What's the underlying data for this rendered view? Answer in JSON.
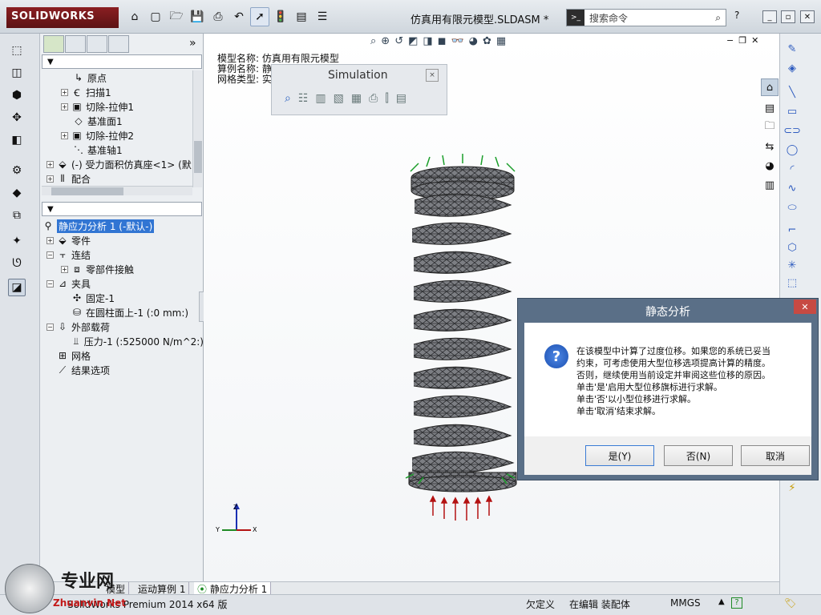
{
  "app": {
    "brand": "SOLIDWORKS",
    "doc_title": "仿真用有限元模型.SLDASM *",
    "search_placeholder": "搜索命令",
    "help": "?"
  },
  "feature_tree": {
    "items": [
      {
        "label": "原点",
        "icon": "origin-icon"
      },
      {
        "label": "扫描1",
        "icon": "sweep-icon"
      },
      {
        "label": "切除-拉伸1",
        "icon": "cut-extrude-icon"
      },
      {
        "label": "基准面1",
        "icon": "plane-icon"
      },
      {
        "label": "切除-拉伸2",
        "icon": "cut-extrude-icon"
      },
      {
        "label": "基准轴1",
        "icon": "axis-icon"
      },
      {
        "label": "(-) 受力面积仿真座<1> (默",
        "icon": "part-icon"
      },
      {
        "label": "配合",
        "icon": "mates-icon"
      }
    ]
  },
  "sim_tree": {
    "study": "静应力分析 1 (-默认-)",
    "items": [
      {
        "label": "零件",
        "icon": "parts-icon"
      },
      {
        "label": "连结",
        "icon": "connections-icon"
      },
      {
        "label": "零部件接触",
        "icon": "contact-icon"
      },
      {
        "label": "夹具",
        "icon": "fixtures-icon"
      },
      {
        "label": "固定-1",
        "icon": "fixed-icon"
      },
      {
        "label": "在圆柱面上-1 (:0 mm:)",
        "icon": "cylinder-fixture-icon"
      },
      {
        "label": "外部载荷",
        "icon": "external-loads-icon"
      },
      {
        "label": "压力-1 (:525000 N/m^2:)",
        "icon": "pressure-icon"
      },
      {
        "label": "网格",
        "icon": "mesh-icon"
      },
      {
        "label": "结果选项",
        "icon": "result-options-icon"
      }
    ]
  },
  "viewport": {
    "model_name": "模型名称: 仿真用有限元模型",
    "case_name": "算例名称: 静",
    "mesh_type": "网格类型: 实"
  },
  "simulation_toolbar": {
    "title": "Simulation"
  },
  "dialog": {
    "title": "静态分析",
    "message_lines": [
      "在该模型中计算了过度位移。如果您的系统已妥当",
      "约束，可考虑使用大型位移选项提高计算的精度。",
      "否则，继续使用当前设定并审阅这些位移的原因。",
      "单击'是'启用大型位移旗标进行求解。",
      "单击'否'以小型位移进行求解。",
      "单击'取消'结束求解。"
    ],
    "yes": "是(Y)",
    "no": "否(N)",
    "cancel": "取消"
  },
  "tabs": [
    {
      "label": "模型"
    },
    {
      "label": "运动算例 1"
    },
    {
      "label": "静应力分析 1"
    }
  ],
  "status": {
    "version": "SolidWorks Premium 2014 x64 版",
    "state": "欠定义",
    "mode": "在编辑 装配体",
    "units": "MMGS",
    "help": "?"
  },
  "watermark": {
    "site": "专业网",
    "url": "Zhuanvin Net"
  },
  "colors": {
    "accent": "#3175d3",
    "dialog_frame": "#5a6f87",
    "close_red": "#c74a43",
    "mesh_gray": "#6e7075"
  }
}
